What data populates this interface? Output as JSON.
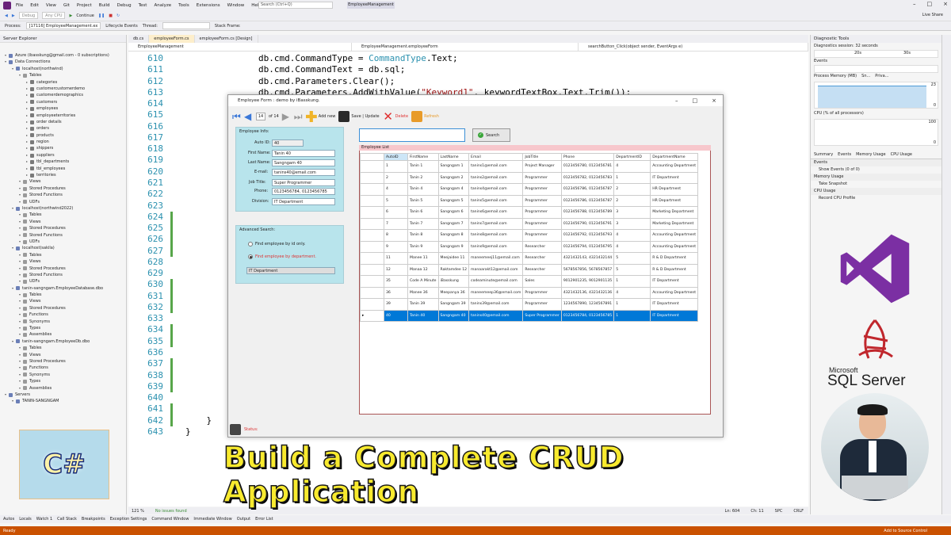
{
  "menu": {
    "items": [
      "File",
      "Edit",
      "View",
      "Git",
      "Project",
      "Build",
      "Debug",
      "Test",
      "Analyze",
      "Tools",
      "Extensions",
      "Window",
      "Help"
    ],
    "search": "Search (Ctrl+Q)",
    "solution": "EmployeeManagement",
    "live_share": "Live Share"
  },
  "toolbar": {
    "config": "Debug",
    "cpu": "Any CPU",
    "continue": "Continue",
    "process_label": "Process:",
    "process": "[17116] EmployeeManagement.ex",
    "lifecycle": "Lifecycle Events",
    "thread": "Thread:",
    "stack": "Stack Frame:"
  },
  "server_explorer": {
    "title": "Server Explorer",
    "rows": [
      {
        "t": "Azure (ibasskung@gmail.com - 0 subscriptions)",
        "l": 0,
        "db": true
      },
      {
        "t": "Data Connections",
        "l": 0,
        "db": true
      },
      {
        "t": "localhost(northwind)",
        "l": 1,
        "db": true
      },
      {
        "t": "Tables",
        "l": 2
      },
      {
        "t": "categories",
        "l": 3,
        "tb": true
      },
      {
        "t": "customercustomerdemo",
        "l": 3,
        "tb": true
      },
      {
        "t": "customerdemographics",
        "l": 3,
        "tb": true
      },
      {
        "t": "customers",
        "l": 3,
        "tb": true
      },
      {
        "t": "employees",
        "l": 3,
        "tb": true
      },
      {
        "t": "employeeterritories",
        "l": 3,
        "tb": true
      },
      {
        "t": "order details",
        "l": 3,
        "tb": true
      },
      {
        "t": "orders",
        "l": 3,
        "tb": true
      },
      {
        "t": "products",
        "l": 3,
        "tb": true
      },
      {
        "t": "region",
        "l": 3,
        "tb": true
      },
      {
        "t": "shippers",
        "l": 3,
        "tb": true
      },
      {
        "t": "suppliers",
        "l": 3,
        "tb": true
      },
      {
        "t": "tbl_departments",
        "l": 3,
        "tb": true
      },
      {
        "t": "tbl_employees",
        "l": 3,
        "tb": true
      },
      {
        "t": "territories",
        "l": 3,
        "tb": true
      },
      {
        "t": "Views",
        "l": 2
      },
      {
        "t": "Stored Procedures",
        "l": 2
      },
      {
        "t": "Stored Functions",
        "l": 2
      },
      {
        "t": "UDFs",
        "l": 2
      },
      {
        "t": "localhost(northwind2022)",
        "l": 1,
        "db": true
      },
      {
        "t": "Tables",
        "l": 2
      },
      {
        "t": "Views",
        "l": 2
      },
      {
        "t": "Stored Procedures",
        "l": 2
      },
      {
        "t": "Stored Functions",
        "l": 2
      },
      {
        "t": "UDFs",
        "l": 2
      },
      {
        "t": "localhost(sakila)",
        "l": 1,
        "db": true
      },
      {
        "t": "Tables",
        "l": 2
      },
      {
        "t": "Views",
        "l": 2
      },
      {
        "t": "Stored Procedures",
        "l": 2
      },
      {
        "t": "Stored Functions",
        "l": 2
      },
      {
        "t": "UDFs",
        "l": 2
      },
      {
        "t": "tanin-sangngam.EmployeeDatabase.dbo",
        "l": 1,
        "db": true
      },
      {
        "t": "Tables",
        "l": 2
      },
      {
        "t": "Views",
        "l": 2
      },
      {
        "t": "Stored Procedures",
        "l": 2
      },
      {
        "t": "Functions",
        "l": 2
      },
      {
        "t": "Synonyms",
        "l": 2
      },
      {
        "t": "Types",
        "l": 2
      },
      {
        "t": "Assemblies",
        "l": 2
      },
      {
        "t": "tanin-sangngam.EmployeeDb.dbo",
        "l": 1,
        "db": true
      },
      {
        "t": "Tables",
        "l": 2
      },
      {
        "t": "Views",
        "l": 2
      },
      {
        "t": "Stored Procedures",
        "l": 2
      },
      {
        "t": "Functions",
        "l": 2
      },
      {
        "t": "Synonyms",
        "l": 2
      },
      {
        "t": "Types",
        "l": 2
      },
      {
        "t": "Assemblies",
        "l": 2
      },
      {
        "t": "Servers",
        "l": 0,
        "db": true
      },
      {
        "t": "TANIN-SANGNGAM",
        "l": 1,
        "db": true
      }
    ]
  },
  "csharp_logo": "C#",
  "tabs": [
    "db.cs",
    "employeeForm.cs",
    "employeeForm.cs [Design]"
  ],
  "nav": {
    "project": "EmployeeManagement",
    "class": "EmployeeManagement.employeeForm",
    "method": "searchButton_Click(object sender, EventArgs e)"
  },
  "lines": [
    {
      "n": "610",
      "c": "db.cmd.CommandType = CommandType.Text;"
    },
    {
      "n": "611",
      "c": "db.cmd.CommandText = db.sql;"
    },
    {
      "n": "612",
      "c": "db.cmd.Parameters.Clear();"
    },
    {
      "n": "613",
      "c": "db.cmd.Parameters.AddWithValue(\"Keyword1\", keywordTextBox.Text.Trim());"
    },
    {
      "n": "614",
      "c": ""
    },
    {
      "n": "615",
      "c": ""
    },
    {
      "n": "616",
      "c": ""
    },
    {
      "n": "617",
      "c": ""
    },
    {
      "n": "618",
      "c": ""
    },
    {
      "n": "619",
      "c": ""
    },
    {
      "n": "620",
      "c": ""
    },
    {
      "n": "621",
      "c": ""
    },
    {
      "n": "622",
      "c": ""
    },
    {
      "n": "623",
      "c": ""
    },
    {
      "n": "624",
      "c": ""
    },
    {
      "n": "625",
      "c": ""
    },
    {
      "n": "626",
      "c": ""
    },
    {
      "n": "627",
      "c": ""
    },
    {
      "n": "628",
      "c": ""
    },
    {
      "n": "629",
      "c": ""
    },
    {
      "n": "630",
      "c": ""
    },
    {
      "n": "631",
      "c": ""
    },
    {
      "n": "632",
      "c": ""
    },
    {
      "n": "633",
      "c": ""
    },
    {
      "n": "634",
      "c": ""
    },
    {
      "n": "635",
      "c": ""
    },
    {
      "n": "636",
      "c": ""
    },
    {
      "n": "637",
      "c": ""
    },
    {
      "n": "638",
      "c": ""
    },
    {
      "n": "639",
      "c": ""
    },
    {
      "n": "640",
      "c": ""
    },
    {
      "n": "641",
      "c": "        }"
    },
    {
      "n": "642",
      "c": "    }"
    },
    {
      "n": "643",
      "c": "}"
    }
  ],
  "editor_status": {
    "zoom": "121 %",
    "issues": "No issues found",
    "ln": "Ln: 604",
    "ch": "Ch: 11",
    "spc": "SPC",
    "crlf": "CRLF"
  },
  "bottom_tabs": [
    "Autos",
    "Locals",
    "Watch 1",
    "Call Stack",
    "Breakpoints",
    "Exception Settings",
    "Command Window",
    "Immediate Window",
    "Output",
    "Error List"
  ],
  "status": {
    "ready": "Ready",
    "source_control": "Add to Source Control"
  },
  "diagnostics": {
    "title": "Diagnostic Tools",
    "session": "Diagnostics session: 32 seconds",
    "t20": "20s",
    "t30": "30s",
    "events": "Events",
    "mem": "Process Memory (MB)",
    "mem_legend": "Sn...",
    "mem_legend2": "Priva...",
    "cpu": "CPU (% of all processors)",
    "v23": "23",
    "v0": "0",
    "v100": "100",
    "tabs": [
      "Summary",
      "Events",
      "Memory Usage",
      "CPU Usage"
    ],
    "ev_h": "Events",
    "show_events": "Show Events (0 of 0)",
    "mu_h": "Memory Usage",
    "snapshot": "Take Snapshot",
    "cu_h": "CPU Usage",
    "record": "Record CPU Profile"
  },
  "form": {
    "title": "Employee Form : demo by iBasskung.",
    "page": "14",
    "of": "of 14",
    "add": "Add new",
    "save": "Save | Update",
    "delete": "Delete",
    "refresh": "Refresh",
    "info_h": "Employee Info:",
    "lbl_id": "Auto ID:",
    "lbl_first": "First Name:",
    "lbl_last": "Last Name:",
    "lbl_email": "E-mail:",
    "lbl_job": "Job Title:",
    "lbl_phone": "Phone:",
    "lbl_div": "Division:",
    "v_id": "40",
    "v_first": "Tanin 40",
    "v_last": "Sangngam 40",
    "v_email": "tanins40@email.com",
    "v_job": "Super Programmer",
    "v_phone": "0123456784, 0123456785",
    "v_div": "IT Department",
    "adv_h": "Advanced Search:",
    "r1": "Find employee by id only.",
    "r2": "Find employee by department.",
    "dept": "IT Department",
    "search_btn": "Search",
    "list_h": "Employee List",
    "status": "Status:"
  },
  "grid": {
    "cols": [
      "AutoID",
      "FirstName",
      "LastName",
      "Email",
      "JobTitle",
      "Phone",
      "DepartmentID",
      "DepartmentName"
    ],
    "rows": [
      [
        "1",
        "Tanin 1",
        "Sangngam 1",
        "tanins1@email.com",
        "Project Manager",
        "0123456780, 0123456781",
        "4",
        "Accounting Department"
      ],
      [
        "2",
        "Tanin 2",
        "Sangngam 2",
        "tanins2@email.com",
        "Programmer",
        "0123456782, 0123456783",
        "1",
        "IT Department"
      ],
      [
        "4",
        "Tanin 4",
        "Sangngam 4",
        "tanins4@email.com",
        "Programmer",
        "0123456786, 0123456787",
        "2",
        "HR Department"
      ],
      [
        "5",
        "Tanin 5",
        "Sangngam 5",
        "tanins5@email.com",
        "Programmer",
        "0123456786, 0123456787",
        "2",
        "HR Department"
      ],
      [
        "6",
        "Tanin 6",
        "Sangngam 6",
        "tanins6@email.com",
        "Programmer",
        "0123456788, 0123456789",
        "3",
        "Marketing Department"
      ],
      [
        "7",
        "Tanin 7",
        "Sangngam 7",
        "tanins7@email.com",
        "Programmer",
        "0123456790, 0123456791",
        "3",
        "Marketing Department"
      ],
      [
        "8",
        "Tanin 8",
        "Sangngam 8",
        "tanins8@email.com",
        "Programmer",
        "0123456792, 0123456793",
        "4",
        "Accounting Department"
      ],
      [
        "9",
        "Tanin 9",
        "Sangngam 9",
        "tanins9@email.com",
        "Researcher",
        "0123456794, 0123456795",
        "4",
        "Accounting Department"
      ],
      [
        "11",
        "Manee 11",
        "Meejaidee 11",
        "maneemeej11@email.com",
        "Researcher",
        "4321432143, 4321432144",
        "5",
        "R & D Department"
      ],
      [
        "12",
        "Manaa 12",
        "Raktamdee 12",
        "manaarakt12@email.com",
        "Researcher",
        "5678567856, 5678567857",
        "5",
        "R & D Department"
      ],
      [
        "35",
        "Code A Minute",
        "iBasskung",
        "codeaminute@email.com",
        "Sales",
        "9012901235, 9012901135",
        "1",
        "IT Department"
      ],
      [
        "36",
        "Manee 36",
        "Meepanya 36",
        "maneemeep36@email.com",
        "Programmer",
        "4321432136, 4321432136",
        "4",
        "Accounting Department"
      ],
      [
        "39",
        "Tanin 39",
        "Sangngam 39",
        "tanins39@email.com",
        "Programmer",
        "1234567890, 1234567891",
        "1",
        "IT Department"
      ],
      [
        "40",
        "Tanin 40",
        "Sangngam 40",
        "tanins40@email.com",
        "Super Programmer",
        "0123456784, 0123456785",
        "1",
        "IT Department"
      ]
    ]
  },
  "banner": "Build a Complete CRUD Application",
  "sql_logo": {
    "line1": "Microsoft",
    "line2": "SQL Server"
  },
  "colors": {
    "accent": "#68217a",
    "status": "#ca5100",
    "selection": "#0078d7",
    "banner": "#f8ea2e"
  }
}
